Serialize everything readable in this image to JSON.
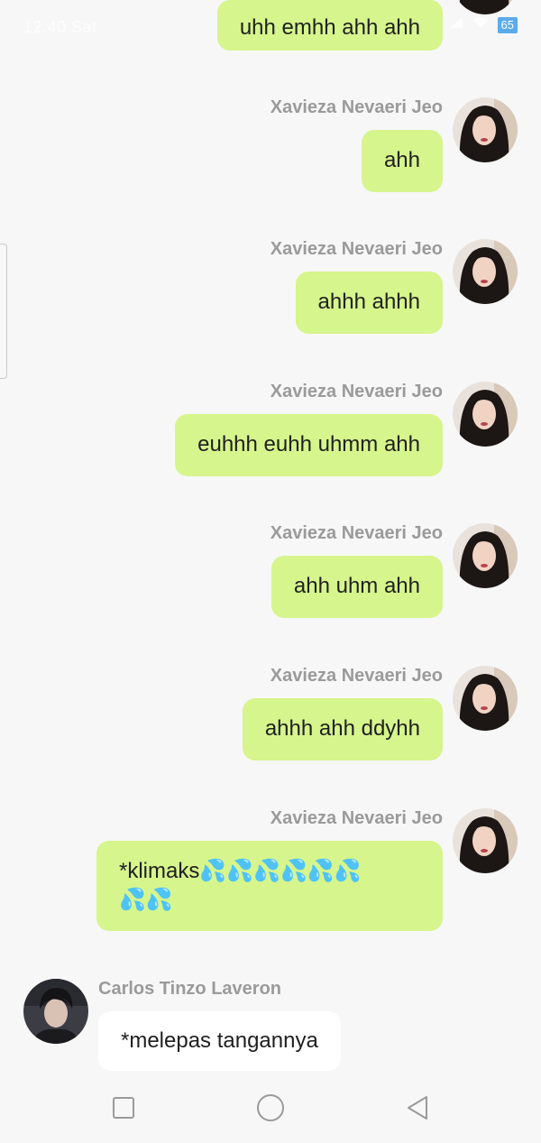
{
  "status_bar": {
    "time": "12.40 Sat",
    "battery": "65"
  },
  "messages": [
    {
      "side": "right",
      "sender": "",
      "text": "uhh emhh ahh ahh",
      "avatar": "female-avatar"
    },
    {
      "side": "right",
      "sender": "Xavieza Nevaeri Jeo",
      "text": "ahh",
      "avatar": "female-avatar"
    },
    {
      "side": "right",
      "sender": "Xavieza Nevaeri Jeo",
      "text": "ahhh ahhh",
      "avatar": "female-avatar"
    },
    {
      "side": "right",
      "sender": "Xavieza Nevaeri Jeo",
      "text": "euhhh euhh uhmm ahh",
      "avatar": "female-avatar"
    },
    {
      "side": "right",
      "sender": "Xavieza Nevaeri Jeo",
      "text": "ahh uhm ahh",
      "avatar": "female-avatar"
    },
    {
      "side": "right",
      "sender": "Xavieza Nevaeri Jeo",
      "text": "ahhh ahh ddyhh",
      "avatar": "female-avatar"
    },
    {
      "side": "right",
      "sender": "Xavieza Nevaeri Jeo",
      "text_line1": "*klimaks💦💦💦💦💦💦",
      "text_line2": "💦💦",
      "avatar": "female-avatar"
    },
    {
      "side": "left",
      "sender": "Carlos Tinzo Laveron",
      "text": "*melepas tangannya",
      "avatar": "male-avatar"
    }
  ],
  "colors": {
    "outgoing_bubble": "#d6f58c",
    "incoming_bubble": "#ffffff",
    "sender_name": "#9a9a9a",
    "background": "#f7f7f7"
  },
  "nav": {
    "recent_icon": "square-icon",
    "home_icon": "circle-icon",
    "back_icon": "triangle-back-icon"
  }
}
